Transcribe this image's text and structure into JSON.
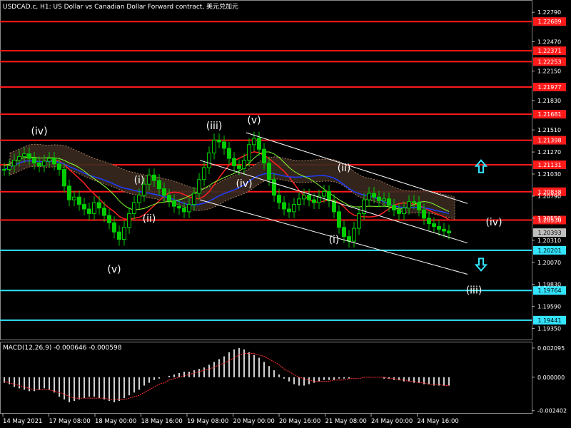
{
  "header": {
    "title": "USDCAD.c, H1:  US Dollar vs Canadian Dollar Forward contract, 美元兑加元"
  },
  "macd": {
    "label": "MACD(12,26,9) -0.000646 -0.000598"
  },
  "colors": {
    "background": "#000000",
    "candle": "#00cc00",
    "resistance": "#ff1a1a",
    "support": "#33e5ff",
    "macd_hist": "#d0d0d0",
    "macd_signal": "#ff3030",
    "channel": "#ffffff",
    "arrow": "#33e5ff"
  },
  "chart_data": [
    {
      "type": "candlestick",
      "symbol": "USDCAD.c",
      "timeframe": "H1",
      "ylim": [
        1.193,
        1.229
      ],
      "y_ticks": [
        "1.22790",
        "1.22470",
        "1.22150",
        "1.21830",
        "1.21510",
        "1.21270",
        "1.21030",
        "1.20790",
        "1.20550",
        "1.20310",
        "1.20070",
        "1.19830",
        "1.19590",
        "1.19350"
      ],
      "x_ticks": [
        "14 May 2021",
        "17 May 08:00",
        "18 May 00:00",
        "18 May 16:00",
        "19 May 08:00",
        "20 May 00:00",
        "20 May 16:00",
        "21 May 08:00",
        "24 May 00:00",
        "24 May 16:00"
      ],
      "levels": [
        {
          "value": "1.22689",
          "kind": "resistance"
        },
        {
          "value": "1.22371",
          "kind": "resistance"
        },
        {
          "value": "1.22253",
          "kind": "resistance"
        },
        {
          "value": "1.21977",
          "kind": "resistance"
        },
        {
          "value": "1.21681",
          "kind": "resistance"
        },
        {
          "value": "1.21398",
          "kind": "resistance"
        },
        {
          "value": "1.21131",
          "kind": "resistance"
        },
        {
          "value": "1.20838",
          "kind": "resistance"
        },
        {
          "value": "1.20530",
          "kind": "resistance"
        },
        {
          "value": "1.20201",
          "kind": "support"
        },
        {
          "value": "1.19764",
          "kind": "support"
        },
        {
          "value": "1.19441",
          "kind": "support"
        }
      ],
      "current_price": "1.20393",
      "wave_labels": [
        "(iv)",
        "(i)",
        "(ii)",
        "(v)",
        "(iii)",
        "(v)",
        "(iv)",
        "(ii)",
        "(i)",
        "(iv)",
        "(iii)"
      ],
      "close": [
        1.2108,
        1.2112,
        1.2118,
        1.2122,
        1.2125,
        1.212,
        1.2115,
        1.2112,
        1.2117,
        1.212,
        1.2114,
        1.2108,
        1.209,
        1.2075,
        1.2078,
        1.207,
        1.2065,
        1.206,
        1.2072,
        1.2066,
        1.2058,
        1.205,
        1.204,
        1.2032,
        1.2045,
        1.206,
        1.2072,
        1.208,
        1.2092,
        1.2102,
        1.2096,
        1.2087,
        1.208,
        1.2074,
        1.2068,
        1.2066,
        1.2062,
        1.207,
        1.2082,
        1.2097,
        1.211,
        1.2126,
        1.214,
        1.2138,
        1.2131,
        1.212,
        1.2112,
        1.2109,
        1.2118,
        1.2135,
        1.2142,
        1.213,
        1.2115,
        1.2097,
        1.208,
        1.2072,
        1.2065,
        1.2062,
        1.207,
        1.2076,
        1.208,
        1.2075,
        1.2072,
        1.2079,
        1.2084,
        1.2074,
        1.2062,
        1.2045,
        1.2035,
        1.203,
        1.2044,
        1.206,
        1.2075,
        1.2082,
        1.2078,
        1.2074,
        1.2076,
        1.2069,
        1.2064,
        1.206,
        1.2066,
        1.2073,
        1.2072,
        1.2064,
        1.2055,
        1.2049,
        1.2046,
        1.2043,
        1.2041,
        1.2039
      ]
    },
    {
      "type": "histogram",
      "name": "MACD(12,26,9)",
      "ylim": [
        -0.00252,
        0.0024
      ],
      "y_ticks": [
        "0.002095",
        "0.000000",
        "-0.002402"
      ],
      "histogram": [
        -0.0004,
        -0.0005,
        -0.0007,
        -0.0008,
        -0.0009,
        -0.001,
        -0.001,
        -0.0009,
        -0.0008,
        -0.0009,
        -0.0011,
        -0.0014,
        -0.0016,
        -0.0018,
        -0.0017,
        -0.0016,
        -0.0015,
        -0.0014,
        -0.0014,
        -0.0015,
        -0.0016,
        -0.0017,
        -0.0018,
        -0.0017,
        -0.0015,
        -0.0013,
        -0.0011,
        -0.0009,
        -0.0006,
        -0.0004,
        -0.0002,
        -0.0001,
        0.0,
        0.0001,
        0.0002,
        0.0003,
        0.0004,
        0.0004,
        0.0005,
        0.0006,
        0.0007,
        0.0009,
        0.0011,
        0.0013,
        0.0015,
        0.0018,
        0.002,
        0.0021,
        0.002,
        0.0018,
        0.0016,
        0.0014,
        0.0011,
        0.0008,
        0.0005,
        0.0002,
        -0.0001,
        -0.0003,
        -0.0005,
        -0.0006,
        -0.0006,
        -0.0005,
        -0.0004,
        -0.0003,
        -0.0002,
        -0.0002,
        -0.0002,
        -0.0001,
        -0.0001,
        -0.0001,
        0.0,
        0.0,
        0.0,
        0.0,
        0.0,
        0.0,
        -0.0001,
        -0.0001,
        -0.0002,
        -0.0002,
        -0.0003,
        -0.0003,
        -0.0004,
        -0.0004,
        -0.0005,
        -0.0005,
        -0.0006,
        -0.0006,
        -0.0006,
        -0.0006
      ],
      "signal": [
        -0.0003,
        -0.0004,
        -0.0005,
        -0.0006,
        -0.0007,
        -0.0008,
        -0.0009,
        -0.0009,
        -0.0009,
        -0.0009,
        -0.001,
        -0.0011,
        -0.0012,
        -0.0014,
        -0.0015,
        -0.0015,
        -0.0015,
        -0.0015,
        -0.0015,
        -0.0015,
        -0.0015,
        -0.0016,
        -0.0016,
        -0.0016,
        -0.0016,
        -0.0015,
        -0.0014,
        -0.0013,
        -0.0011,
        -0.0009,
        -0.0007,
        -0.0005,
        -0.0004,
        -0.0002,
        -0.0001,
        0.0,
        0.0001,
        0.0002,
        0.0003,
        0.0004,
        0.0005,
        0.0006,
        0.0007,
        0.0009,
        0.001,
        0.0012,
        0.0014,
        0.0016,
        0.0017,
        0.0017,
        0.0017,
        0.0016,
        0.0015,
        0.0013,
        0.0011,
        0.0009,
        0.0006,
        0.0004,
        0.0002,
        0.0,
        -0.0001,
        -0.0002,
        -0.0003,
        -0.0003,
        -0.0003,
        -0.0003,
        -0.0002,
        -0.0002,
        -0.0002,
        -0.0001,
        -0.0001,
        -0.0001,
        0.0,
        0.0,
        0.0,
        0.0,
        0.0,
        -0.0001,
        -0.0001,
        -0.0002,
        -0.0002,
        -0.0003,
        -0.0003,
        -0.0004,
        -0.0004,
        -0.0005,
        -0.0005,
        -0.0005,
        -0.0006,
        -0.0006
      ]
    }
  ]
}
